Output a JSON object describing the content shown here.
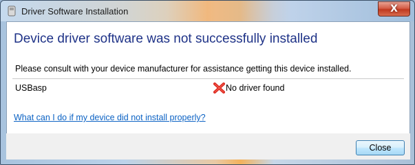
{
  "window": {
    "title": "Driver Software Installation",
    "close_glyph": "X"
  },
  "dialog": {
    "heading": "Device driver software was not successfully installed",
    "message": "Please consult with your device manufacturer for assistance getting this device installed.",
    "device": {
      "name": "USBasp",
      "status": "No driver found",
      "status_icon": "red-x-icon",
      "status_color": "#d9231c"
    },
    "help_link": "What can I do if my device did not install properly?",
    "close_button": "Close"
  },
  "colors": {
    "heading": "#1e3287",
    "link": "#0b62c4"
  }
}
